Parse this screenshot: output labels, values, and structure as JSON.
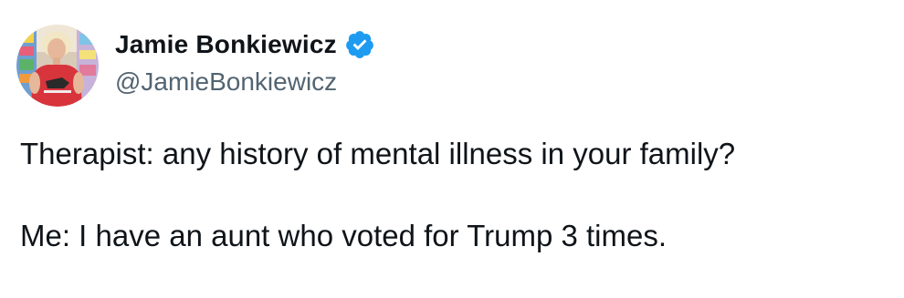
{
  "author": {
    "display_name": "Jamie Bonkiewicz",
    "handle": "@JamieBonkiewicz",
    "verified": true,
    "verified_icon": "verified-badge-icon",
    "verified_color": "#1d9bf0"
  },
  "tweet": {
    "lines": [
      "Therapist: any history of mental illness in your family?",
      "Me: I have an aunt who voted for Trump 3 times."
    ]
  },
  "colors": {
    "text_primary": "#0f1419",
    "text_secondary": "#536471",
    "background": "#ffffff"
  }
}
